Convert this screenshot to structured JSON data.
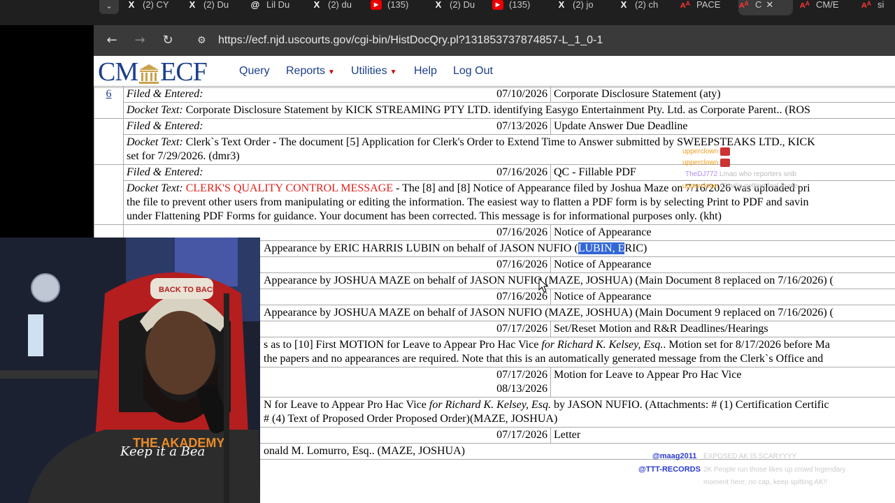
{
  "browser": {
    "tabs": [
      {
        "icon": "x-logo-icon",
        "label": "(2) CY"
      },
      {
        "icon": "x-logo-icon",
        "label": "(2) Du"
      },
      {
        "icon": "threads-icon",
        "label": "Lil Du"
      },
      {
        "icon": "x-logo-icon",
        "label": "(2) du"
      },
      {
        "icon": "youtube-icon",
        "label": "(135)"
      },
      {
        "icon": "x-logo-icon",
        "label": "(2) Du"
      },
      {
        "icon": "youtube-icon",
        "label": "(135)"
      },
      {
        "icon": "x-logo-icon",
        "label": "(2) jo"
      },
      {
        "icon": "x-logo-icon",
        "label": "(2) ch"
      },
      {
        "icon": "pacer-icon",
        "label": "PACE"
      },
      {
        "icon": "pacer-icon",
        "label": "C"
      },
      {
        "icon": "pacer-icon",
        "label": "CM/E"
      },
      {
        "icon": "pacer-icon",
        "label": "si"
      }
    ],
    "url": "https://ecf.njd.uscourts.gov/cgi-bin/HistDocQry.pl?131853737874857-L_1_0-1"
  },
  "ecf": {
    "logo_left": "CM",
    "logo_right": "ECF",
    "menu": {
      "query": "Query",
      "reports": "Reports",
      "utilities": "Utilities",
      "help": "Help",
      "logout": "Log Out"
    }
  },
  "labels": {
    "filed": "Filed & Entered:",
    "docket_text": "Docket Text:"
  },
  "entries": [
    {
      "num": "6",
      "date": "07/10/2026",
      "type": "Corporate Disclosure Statement (aty)",
      "text": "Corporate Disclosure Statement by KICK STREAMING PTY LTD. identifying Easygo Entertainment Pty. Ltd. as Corporate Parent.. (ROS"
    },
    {
      "date": "07/13/2026",
      "type": "Update Answer Due Deadline",
      "text": "Clerk`s Text Order - The document [5] Application for Clerk's Order to Extend Time to Answer submitted by SWEEPSTEAKS LTD., KICK",
      "text2": "set for 7/29/2026. (dmr3)"
    },
    {
      "date": "07/16/2026",
      "type": "QC - Fillable PDF",
      "red": "CLERK'S QUALITY CONTROL MESSAGE",
      "text": " - The [8] and [8] Notice of Appearance filed by Joshua Maze on 7/16/2026 was uploaded pri",
      "text2": "the file to prevent other users from manipulating or editing the information. The easiest way to flatten a PDF form is by selecting Print to PDF and savin",
      "text3": "under Flattening PDF Forms for guidance. Your document has been corrected. This message is for informational purposes only. (kht)"
    },
    {
      "date": "07/16/2026",
      "type": "Notice of Appearance",
      "text": "Appearance by ERIC HARRIS LUBIN on behalf of JASON NUFIO (",
      "hl": "LUBIN, E",
      "text_end": "RIC)"
    },
    {
      "date": "07/16/2026",
      "type": "Notice of Appearance",
      "text": "Appearance by JOSHUA MAZE on behalf of JASON NUFIO (MAZE, JOSHUA) (Main Document 8 replaced on 7/16/2026) ("
    },
    {
      "date": "07/16/2026",
      "type": "Notice of Appearance",
      "text": "Appearance by JOSHUA MAZE on behalf of JASON NUFIO (MAZE, JOSHUA) (Main Document 9 replaced on 7/16/2026) ("
    },
    {
      "date": "07/17/2026",
      "type": "Set/Reset Motion and R&R Deadlines/Hearings",
      "text": "s as to [10] First MOTION for Leave to Appear Pro Hac Vice ",
      "italic": "for Richard K. Kelsey, Esq.",
      "text_end": ". Motion set for 8/17/2026 before Ma",
      "text2": "the papers and no appearances are required. Note that this is an automatically generated message from the Clerk`s Office and"
    },
    {
      "date": "07/17/2026",
      "date2": "08/13/2026",
      "type": "Motion for Leave to Appear Pro Hac Vice",
      "text": "N for Leave to Appear Pro Hac Vice ",
      "italic": "for Richard K. Kelsey, Esq.",
      "text_end": " by JASON NUFIO. (Attachments: # (1) Certification Certific",
      "text2": "# (4) Text of Proposed Order Proposed Order)(MAZE, JOSHUA)"
    },
    {
      "date": "07/17/2026",
      "type": "Letter",
      "text": "onald M. Lomurro, Esq.. (MAZE, JOSHUA)"
    }
  ],
  "overlay": {
    "webcam_shirt_text": "THE AKADEMY",
    "webcam_shirt_script": "Keep it a Bea",
    "webcam_hat": "BACK TO BACK",
    "chat": [
      {
        "user": "upperclown",
        "msg": ""
      },
      {
        "user": "upperclown",
        "msg": ""
      },
      {
        "user": "TheDJ772",
        "msg": "Lmao who reporters snib"
      },
      {
        "user": "upperclown",
        "msg": "Charlie getting fool to me"
      }
    ],
    "tags": [
      "@maag2011",
      "@TTT-RECORDS"
    ],
    "overlay_chat": [
      "EXPOSED AK IS SCARYYYY",
      "2K People run those likes up crowd legendary",
      "moment here, no cap, keep spitting AK!!"
    ],
    "colors": {
      "link": "#1b3f8b",
      "red": "#e0201b",
      "highlight": "#3367d6"
    }
  }
}
